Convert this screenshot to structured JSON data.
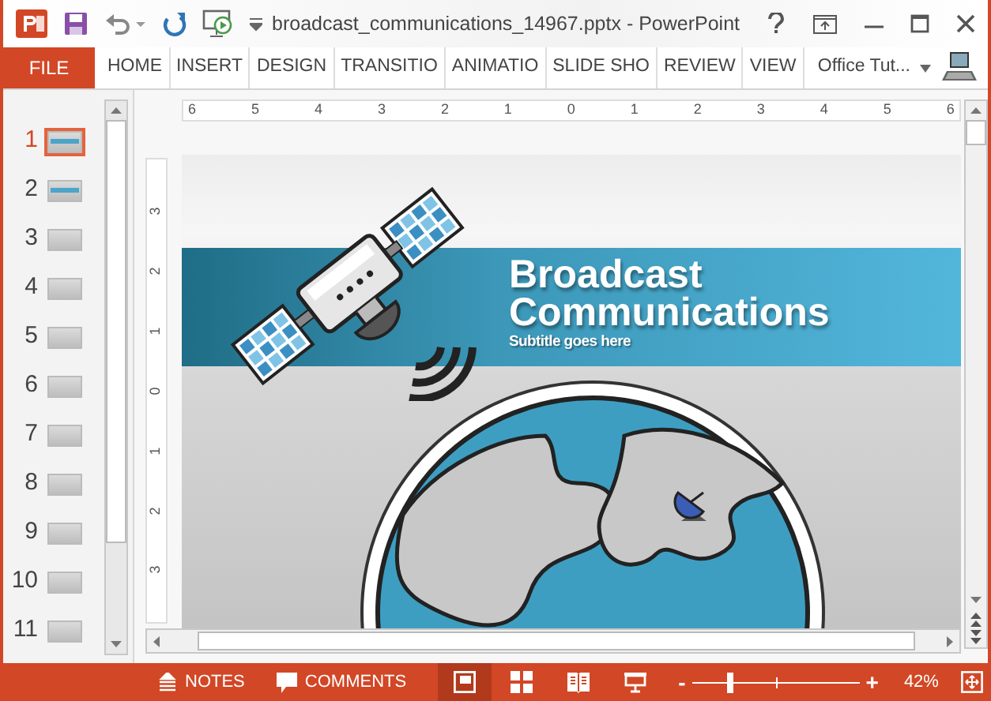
{
  "window": {
    "title": "broadcast_communications_14967.pptx - PowerPoint"
  },
  "ribbon": {
    "tabs": [
      {
        "label": "FILE",
        "kind": "file"
      },
      {
        "label": "HOME",
        "kind": "tab"
      },
      {
        "label": "INSERT",
        "kind": "tab"
      },
      {
        "label": "DESIGN",
        "kind": "tab"
      },
      {
        "label": "TRANSITIO",
        "kind": "tab"
      },
      {
        "label": "ANIMATIO",
        "kind": "tab"
      },
      {
        "label": "SLIDE SHO",
        "kind": "tab"
      },
      {
        "label": "REVIEW",
        "kind": "tab"
      },
      {
        "label": "VIEW",
        "kind": "tab"
      }
    ],
    "account": {
      "name": "Office Tut..."
    }
  },
  "slides": [
    {
      "number": "1",
      "selected": true
    },
    {
      "number": "2",
      "selected": false
    },
    {
      "number": "3",
      "selected": false
    },
    {
      "number": "4",
      "selected": false
    },
    {
      "number": "5",
      "selected": false
    },
    {
      "number": "6",
      "selected": false
    },
    {
      "number": "7",
      "selected": false
    },
    {
      "number": "8",
      "selected": false
    },
    {
      "number": "9",
      "selected": false
    },
    {
      "number": "10",
      "selected": false
    },
    {
      "number": "11",
      "selected": false
    }
  ],
  "rulers": {
    "horizontal": [
      "6",
      "5",
      "4",
      "3",
      "2",
      "1",
      "0",
      "1",
      "2",
      "3",
      "4",
      "5",
      "6"
    ],
    "vertical": [
      "3",
      "2",
      "1",
      "0",
      "1",
      "2",
      "3"
    ]
  },
  "slide": {
    "title": "Broadcast Communications",
    "subtitle": "Subtitle goes here"
  },
  "status_bar": {
    "notes": "NOTES",
    "comments": "COMMENTS",
    "views": [
      {
        "kind": "normal",
        "selected": true
      },
      {
        "kind": "sorter",
        "selected": false
      },
      {
        "kind": "reading",
        "selected": false
      },
      {
        "kind": "slideshow",
        "selected": false
      }
    ],
    "zoom": {
      "minus": "-",
      "plus": "+",
      "level": 0.23,
      "reading": "42%"
    }
  }
}
